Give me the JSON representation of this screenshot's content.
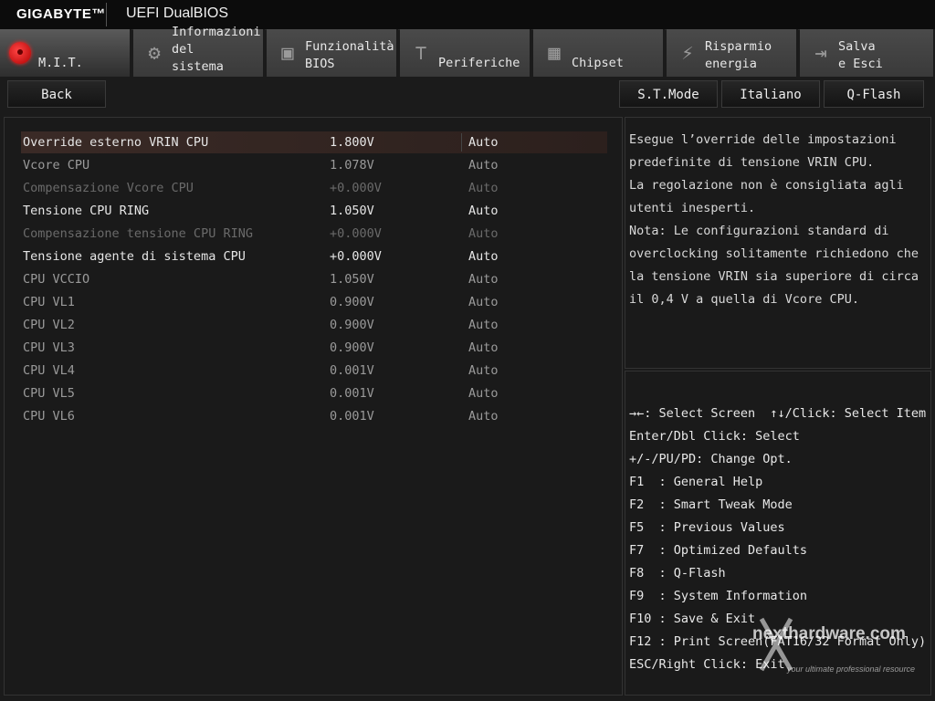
{
  "header": {
    "brand": "GIGABYTE™",
    "product": "UEFI DualBIOS"
  },
  "tabs": [
    {
      "label": "M.I.T.",
      "icon": "mit-red-icon",
      "active": true
    },
    {
      "label": "Informazioni\ndel\nsistema",
      "icon": "gear-icon"
    },
    {
      "label": "Funzionalità\nBIOS",
      "icon": "chip-board-icon"
    },
    {
      "label": "Periferiche",
      "icon": "connector-icon"
    },
    {
      "label": "Chipset",
      "icon": "chipset-icon"
    },
    {
      "label": "Risparmio\nenergia",
      "icon": "energy-icon"
    },
    {
      "label": "Salva\ne Esci",
      "icon": "exit-icon"
    }
  ],
  "subbar": {
    "back": "Back",
    "st_mode": "S.T.Mode",
    "language": "Italiano",
    "qflash": "Q-Flash"
  },
  "settings": [
    {
      "name": "Override esterno VRIN CPU",
      "value": "1.800V",
      "option": "Auto",
      "state": "selected"
    },
    {
      "name": "Vcore CPU",
      "value": "1.078V",
      "option": "Auto",
      "state": "muted"
    },
    {
      "name": "Compensazione Vcore CPU",
      "value": "+0.000V",
      "option": "Auto",
      "state": "dim"
    },
    {
      "name": "Tensione CPU RING",
      "value": "1.050V",
      "option": "Auto",
      "state": "normal"
    },
    {
      "name": "Compensazione tensione CPU RING",
      "value": "+0.000V",
      "option": "Auto",
      "state": "dim"
    },
    {
      "name": "Tensione agente di sistema CPU",
      "value": "+0.000V",
      "option": "Auto",
      "state": "normal"
    },
    {
      "name": "CPU VCCIO",
      "value": "1.050V",
      "option": "Auto",
      "state": "muted"
    },
    {
      "name": "CPU VL1",
      "value": "0.900V",
      "option": "Auto",
      "state": "muted"
    },
    {
      "name": "CPU VL2",
      "value": "0.900V",
      "option": "Auto",
      "state": "muted"
    },
    {
      "name": "CPU VL3",
      "value": "0.900V",
      "option": "Auto",
      "state": "muted"
    },
    {
      "name": "CPU VL4",
      "value": "0.001V",
      "option": "Auto",
      "state": "muted"
    },
    {
      "name": "CPU VL5",
      "value": "0.001V",
      "option": "Auto",
      "state": "muted"
    },
    {
      "name": "CPU VL6",
      "value": "0.001V",
      "option": "Auto",
      "state": "muted"
    }
  ],
  "help": [
    "Esegue l’override delle impostazioni",
    "predefinite di tensione VRIN CPU.",
    "La regolazione non è consigliata agli",
    "utenti inesperti.",
    "Nota: Le configurazioni standard di",
    "overclocking solitamente richiedono che",
    "la tensione VRIN sia superiore di circa",
    "il 0,4 V a quella di Vcore CPU."
  ],
  "keys": [
    "→←: Select Screen  ↑↓/Click: Select Item",
    "Enter/Dbl Click: Select",
    "+/-/PU/PD: Change Opt.",
    "F1  : General Help",
    "F2  : Smart Tweak Mode",
    "F5  : Previous Values",
    "F7  : Optimized Defaults",
    "F8  : Q-Flash",
    "F9  : System Information",
    "F10 : Save & Exit",
    "F12 : Print Screen(FAT16/32 Format Only)",
    "ESC/Right Click: Exit"
  ],
  "watermark": {
    "text": "nexthardware.com",
    "tagline": "your ultimate professional resource"
  },
  "colors": {
    "background": "#1b1b1b",
    "accent_red": "#e01010",
    "selected_row": "#3a2a26"
  }
}
